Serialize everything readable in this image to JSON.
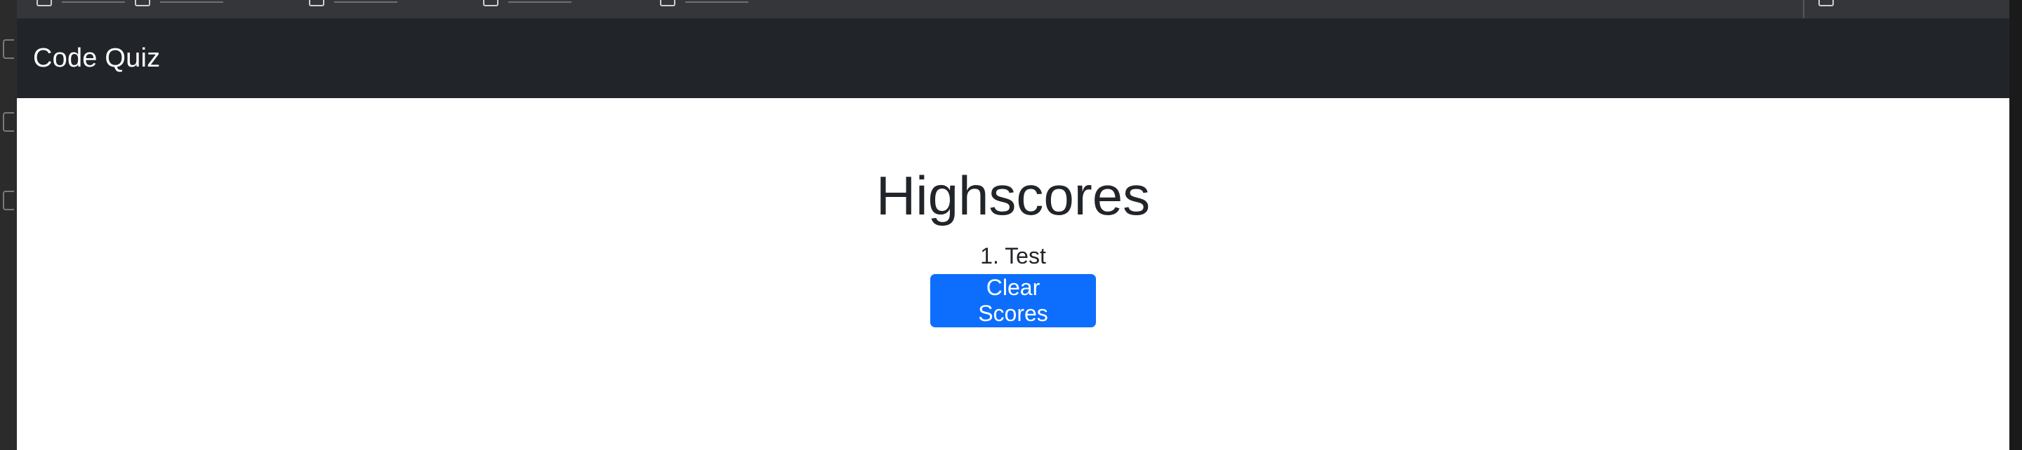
{
  "navbar": {
    "brand": "Code Quiz"
  },
  "main": {
    "title": "Highscores",
    "scores": [
      {
        "label": "1. Test"
      }
    ],
    "clear_button": "Clear Scores"
  },
  "colors": {
    "navbar_bg": "#212529",
    "button_primary": "#0d6efd",
    "page_bg": "#ffffff"
  }
}
